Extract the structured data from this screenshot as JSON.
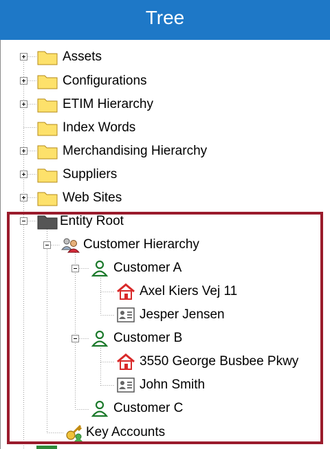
{
  "header": {
    "title": "Tree"
  },
  "colors": {
    "header_bg": "#1e78c7",
    "highlight_border": "#9a1b2c",
    "folder_fill": "#fde16b"
  },
  "tree": {
    "nodes": [
      {
        "label": "Assets",
        "icon": "folder-icon",
        "expander": "plus"
      },
      {
        "label": "Configurations",
        "icon": "folder-icon",
        "expander": "plus"
      },
      {
        "label": "ETIM Hierarchy",
        "icon": "folder-icon",
        "expander": "plus"
      },
      {
        "label": "Index Words",
        "icon": "folder-icon",
        "expander": "none"
      },
      {
        "label": "Merchandising Hierarchy",
        "icon": "folder-icon",
        "expander": "plus"
      },
      {
        "label": "Suppliers",
        "icon": "folder-icon",
        "expander": "plus"
      },
      {
        "label": "Web Sites",
        "icon": "folder-icon",
        "expander": "plus"
      },
      {
        "label": "Entity Root",
        "icon": "dark-folder-icon",
        "expander": "minus"
      },
      {
        "label": "Customer Hierarchy",
        "icon": "user-group-icon",
        "expander": "minus"
      },
      {
        "label": "Customer A",
        "icon": "user-icon",
        "expander": "minus"
      },
      {
        "label": "Axel Kiers Vej 11",
        "icon": "house-icon",
        "expander": "none"
      },
      {
        "label": "Jesper Jensen",
        "icon": "contact-card-icon",
        "expander": "none"
      },
      {
        "label": "Customer B",
        "icon": "user-icon",
        "expander": "minus"
      },
      {
        "label": "3550 George Busbee Pkwy",
        "icon": "house-icon",
        "expander": "none"
      },
      {
        "label": "John Smith",
        "icon": "contact-card-icon",
        "expander": "none"
      },
      {
        "label": "Customer C",
        "icon": "user-icon",
        "expander": "none"
      },
      {
        "label": "Key Accounts",
        "icon": "key-accounts-icon",
        "expander": "none"
      }
    ]
  }
}
